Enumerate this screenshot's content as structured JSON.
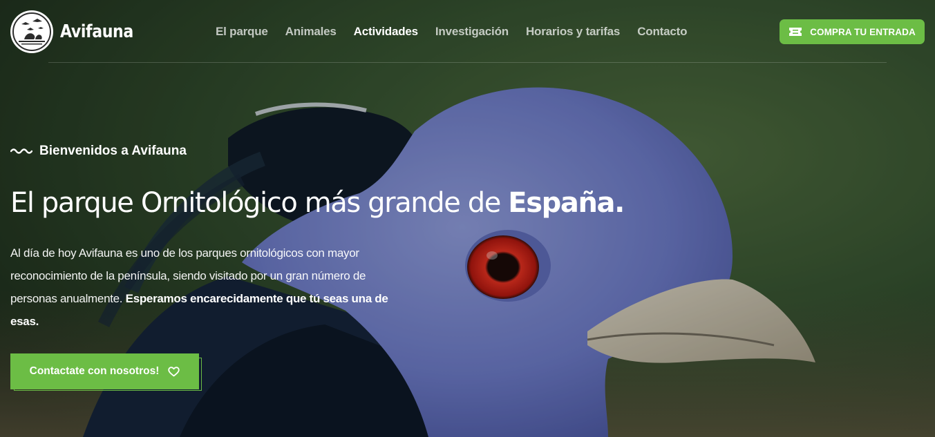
{
  "site": {
    "name": "Avifauna"
  },
  "nav": {
    "items": [
      {
        "label": "El parque",
        "active": false
      },
      {
        "label": "Animales",
        "active": false
      },
      {
        "label": "Actividades",
        "active": true
      },
      {
        "label": "Investigación",
        "active": false
      },
      {
        "label": "Horarios y tarifas",
        "active": false
      },
      {
        "label": "Contacto",
        "active": false
      }
    ]
  },
  "header_cta": {
    "label": "COMPRA TU ENTRADA",
    "icon": "ticket-icon"
  },
  "hero": {
    "eyebrow": "Bienvenidos a Avifauna",
    "eyebrow_icon": "wave-icon",
    "headline_regular": "El parque Ornitológico más grande de ",
    "headline_bold": "España.",
    "lead_regular": "Al día de hoy Avifauna es uno de los parques ornitológicos con mayor reconocimiento de la península, siendo visitado por un gran número de personas anualmente. ",
    "lead_bold": "Esperamos encarecidamente que tú seas una de esas.",
    "button_label": "Contactate con nosotros!",
    "button_icon": "heart-icon",
    "background_image": "blue-crowned-pigeon-photo"
  },
  "colors": {
    "accent": "#6cbd45",
    "text": "#ffffff",
    "background_dark": "#1d2a1e"
  }
}
